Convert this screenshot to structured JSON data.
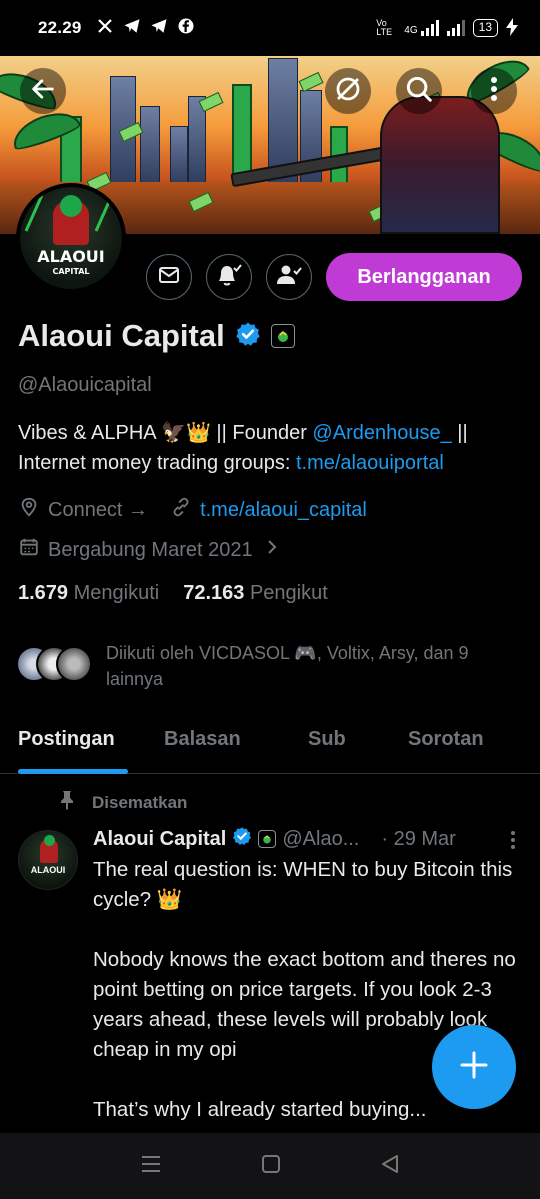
{
  "status_bar": {
    "time": "22.29",
    "notif_icons": [
      "x-icon",
      "telegram-icon",
      "telegram-icon",
      "facebook-icon"
    ],
    "volte": "Vo LTE",
    "network": "4G",
    "battery": "13"
  },
  "banner": {
    "buttons": [
      "back-arrow-icon",
      "hide-icon",
      "search-icon",
      "more-vertical-icon"
    ]
  },
  "avatar": {
    "brand": "ALAOUI",
    "sub": "CAPITAL"
  },
  "actions": {
    "message_icon": "mail-icon",
    "notify_icon": "bell-check-icon",
    "follow_icon": "person-check-icon",
    "subscribe_label": "Berlangganan"
  },
  "profile": {
    "name": "Alaoui Capital",
    "handle": "@Alaouicapital",
    "bio_part1": "Vibes & ALPHA 🦅👑 || Founder ",
    "bio_mention": "@Ardenhouse_",
    "bio_part2": " || Internet money trading groups: ",
    "bio_link": "t.me/alaouiportal",
    "location": "Connect →",
    "website": "t.me/alaoui_capital",
    "joined": "Bergabung Maret 2021",
    "following_count": "1.679",
    "following_label": "Mengikuti",
    "followers_count": "72.163",
    "followers_label": "Pengikut",
    "followed_by": "Diikuti oleh VICDASOL 🎮, Voltix, Arsy, dan 9 lainnya"
  },
  "tabs": [
    "Postingan",
    "Balasan",
    "Sub",
    "Sorotan"
  ],
  "post": {
    "pinned_label": "Disematkan",
    "author": "Alaoui Capital",
    "handle": "@Alao...",
    "date": "· 29 Mar",
    "paragraph1": "The real question is: WHEN to buy Bitcoin this cycle? 👑",
    "paragraph2": "Nobody knows the exact bottom and theres no point betting on price targets. If you look 2-3 years ahead, these levels will probably look cheap in my opi",
    "paragraph3": "That’s why I already started buying..."
  },
  "colors": {
    "accent": "#1d9bf0",
    "subscribe": "#c03ad6",
    "muted": "#71767b",
    "text": "#e7e9ea"
  }
}
